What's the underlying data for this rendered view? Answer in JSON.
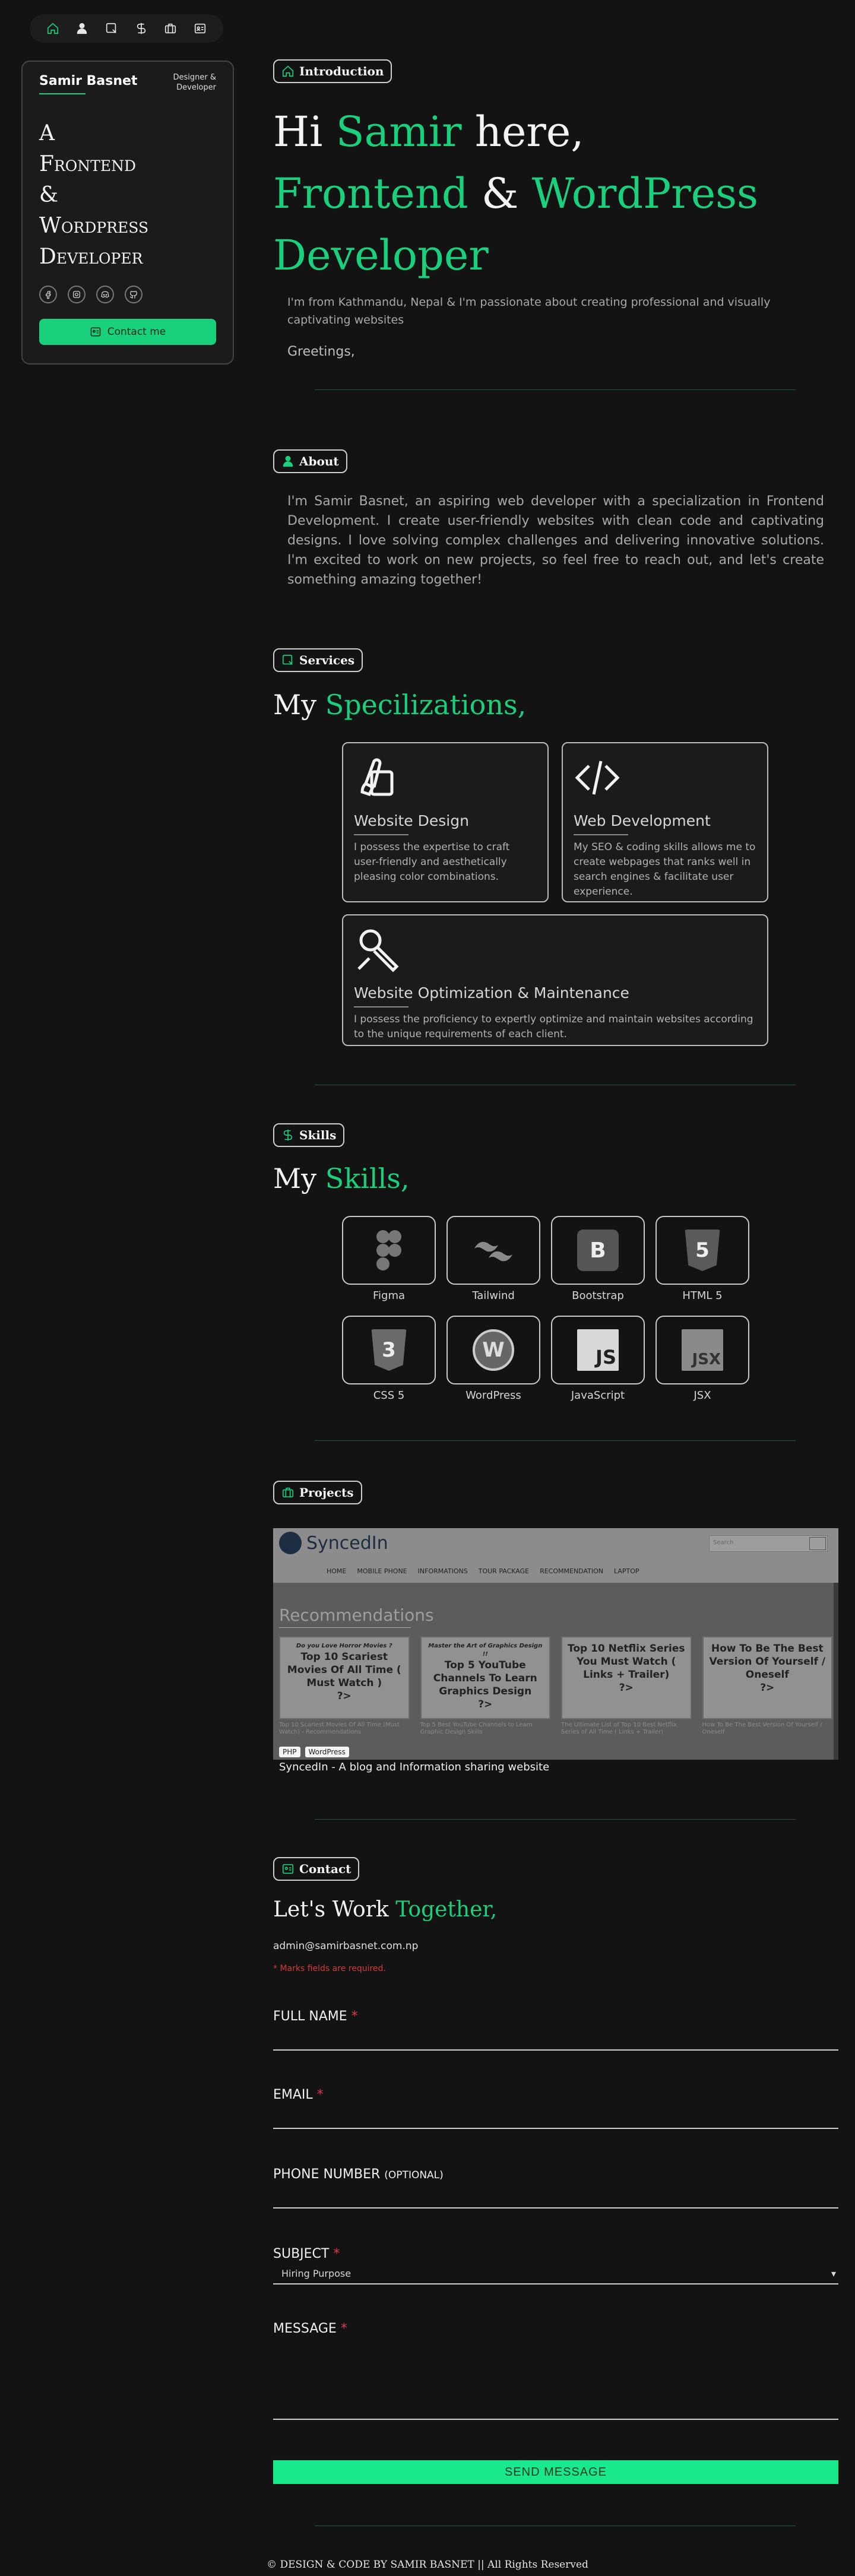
{
  "colors": {
    "accent": "#19d17c",
    "background": "#131313",
    "required": "#e0394a"
  },
  "topnav": {
    "items": [
      {
        "icon": "home-icon"
      },
      {
        "icon": "user-icon"
      },
      {
        "icon": "services-icon"
      },
      {
        "icon": "skills-icon"
      },
      {
        "icon": "briefcase-icon"
      },
      {
        "icon": "contact-card-icon"
      }
    ]
  },
  "profile": {
    "name": "Samir Basnet",
    "role": "Designer &\nDeveloper",
    "tagline_lines": [
      "A",
      "Frontend",
      "&",
      "Wordpress",
      "Developer"
    ],
    "socials": [
      "facebook-icon",
      "instagram-icon",
      "discord-icon",
      "github-icon"
    ],
    "contact_button": "Contact me"
  },
  "intro": {
    "chip": "Introduction",
    "hero_hi": "Hi ",
    "hero_name": "Samir",
    "hero_here": " here,",
    "hero_frontend": "Frontend",
    "hero_amp": " & ",
    "hero_wordpress": "WordPress",
    "hero_developer": "Developer",
    "paragraph": "I'm from Kathmandu, Nepal & I'm passionate about creating professional and visually captivating websites",
    "greeting": "Greetings,"
  },
  "about": {
    "chip": "About",
    "paragraph": "I'm Samir Basnet, an aspiring web developer with a specialization in Frontend Development. I create user-friendly websites with clean code and captivating designs. I love solving complex challenges and delivering innovative solutions. I'm excited to work on new projects, so feel free to reach out, and let's create something amazing together!"
  },
  "services": {
    "chip": "Services",
    "title_my": "My ",
    "title_green": "Specilizations,",
    "items": [
      {
        "title": "Website Design",
        "desc": "I possess the expertise to craft user-friendly and aesthetically pleasing color combinations."
      },
      {
        "title": "Web Development",
        "desc": "My SEO & coding skills allows me to create webpages that ranks well in search engines & facilitate user experience."
      },
      {
        "title": "Website Optimization & Maintenance",
        "desc": "I possess the proficiency to expertly optimize and maintain websites according to the unique requirements of each client."
      }
    ]
  },
  "skills": {
    "chip": "Skills",
    "title_my": "My ",
    "title_green": "Skills,",
    "items": [
      {
        "label": "Figma",
        "logo": "figma"
      },
      {
        "label": "Tailwind",
        "logo": "tailwind"
      },
      {
        "label": "Bootstrap",
        "logo": "B"
      },
      {
        "label": "HTML 5",
        "logo": "5"
      },
      {
        "label": "CSS 5",
        "logo": "3"
      },
      {
        "label": "WordPress",
        "logo": "W"
      },
      {
        "label": "JavaScript",
        "logo": "JS"
      },
      {
        "label": "JSX",
        "logo": "JSX"
      }
    ]
  },
  "projects": {
    "chip": "Projects",
    "preview": {
      "brand": "SyncedIn",
      "search_placeholder": "Search",
      "menu": [
        "HOME",
        "MOBILE PHONE",
        "INFORMATIONS",
        "TOUR PACKAGE",
        "RECOMMENDATION",
        "LAPTOP"
      ],
      "section": "Recommendations",
      "cards": [
        {
          "kicker": "Do you Love Horror Movies ?",
          "title": "Top 10 Scariest Movies Of All Time ( Must Watch )",
          "tail": "?>",
          "caption": "Top 10 Scariest Movies Of All Time (Must Watch) - Recommendations"
        },
        {
          "kicker": "Master the Art of Graphics Design !!",
          "title": "Top 5 YouTube Channels To Learn Graphics Design",
          "tail": "?>",
          "caption": "Top 5 Best YouTube Channels to Learn Graphic Design Skills"
        },
        {
          "kicker": "",
          "title": "Top 10 Netflix Series You Must Watch ( Links + Trailer)",
          "tail": "?>",
          "caption": "The Ultimate List of Top 10 Best Netflix Series of All Time ( Links + Trailer)"
        },
        {
          "kicker": "",
          "title": "How To Be The Best Version Of Yourself / Oneself",
          "tail": "?>",
          "caption": "How To Be The Best Version Of Yourself / Oneself"
        }
      ],
      "tags": [
        "PHP",
        "WordPress"
      ]
    },
    "title": "SyncedIn - A blog and Information sharing website"
  },
  "contact": {
    "chip": "Contact",
    "title_plain": "Let's Work ",
    "title_green": "Together,",
    "email": "admin@samirbasnet.com.np",
    "required_note": "* Marks fields are required.",
    "fields": {
      "full_name": "FULL NAME",
      "email": "EMAIL",
      "phone": "PHONE NUMBER",
      "phone_optional": "(OPTIONAL)",
      "subject": "SUBJECT",
      "subject_value": "Hiring Purpose",
      "message": "MESSAGE",
      "star": "*"
    },
    "send_button": "SEND MESSAGE"
  },
  "footer": {
    "text": "©  DESIGN & CODE BY SAMIR BASNET || All Rights Reserved"
  }
}
